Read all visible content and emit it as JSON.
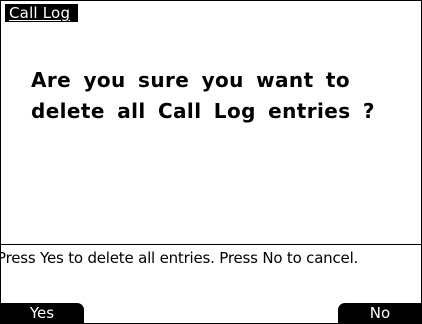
{
  "screen": {
    "title": "Call Log",
    "message": "Are you sure you want to\ndelete all Call Log entries ?",
    "hint": "Press Yes to delete all entries. Press No to cancel."
  },
  "softkeys": {
    "left": "Yes",
    "right": "No"
  }
}
